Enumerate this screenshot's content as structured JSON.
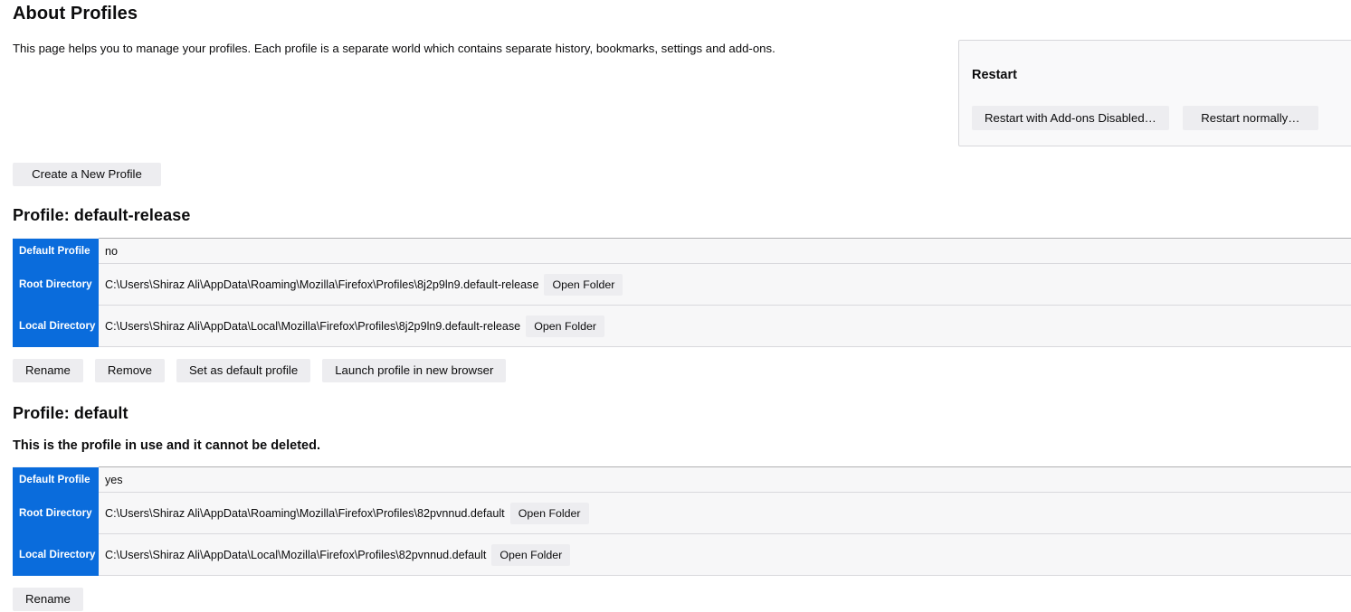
{
  "header": {
    "title": "About Profiles",
    "description": "This page helps you to manage your profiles. Each profile is a separate world which contains separate history, bookmarks, settings and add-ons."
  },
  "restart_panel": {
    "title": "Restart",
    "restart_addons_disabled_label": "Restart with Add-ons Disabled…",
    "restart_normally_label": "Restart normally…"
  },
  "create_profile_label": "Create a New Profile",
  "table_labels": {
    "default_profile": "Default Profile",
    "root_directory": "Root Directory",
    "local_directory": "Local Directory",
    "open_folder": "Open Folder"
  },
  "profiles": [
    {
      "heading": "Profile: default-release",
      "note": "",
      "default_profile": "no",
      "root_directory": "C:\\Users\\Shiraz Ali\\AppData\\Roaming\\Mozilla\\Firefox\\Profiles\\8j2p9ln9.default-release",
      "local_directory": "C:\\Users\\Shiraz Ali\\AppData\\Local\\Mozilla\\Firefox\\Profiles\\8j2p9ln9.default-release",
      "actions": [
        "Rename",
        "Remove",
        "Set as default profile",
        "Launch profile in new browser"
      ]
    },
    {
      "heading": "Profile: default",
      "note": "This is the profile in use and it cannot be deleted.",
      "default_profile": "yes",
      "root_directory": "C:\\Users\\Shiraz Ali\\AppData\\Roaming\\Mozilla\\Firefox\\Profiles\\82pvnnud.default",
      "local_directory": "C:\\Users\\Shiraz Ali\\AppData\\Local\\Mozilla\\Firefox\\Profiles\\82pvnnud.default",
      "actions": [
        "Rename"
      ]
    }
  ],
  "colors": {
    "header_blue": "#0a6cdc",
    "row_background": "#f7f7f8",
    "button_background": "#ededf0",
    "panel_background": "#f9f9fa",
    "text": "#0c0c0d"
  }
}
